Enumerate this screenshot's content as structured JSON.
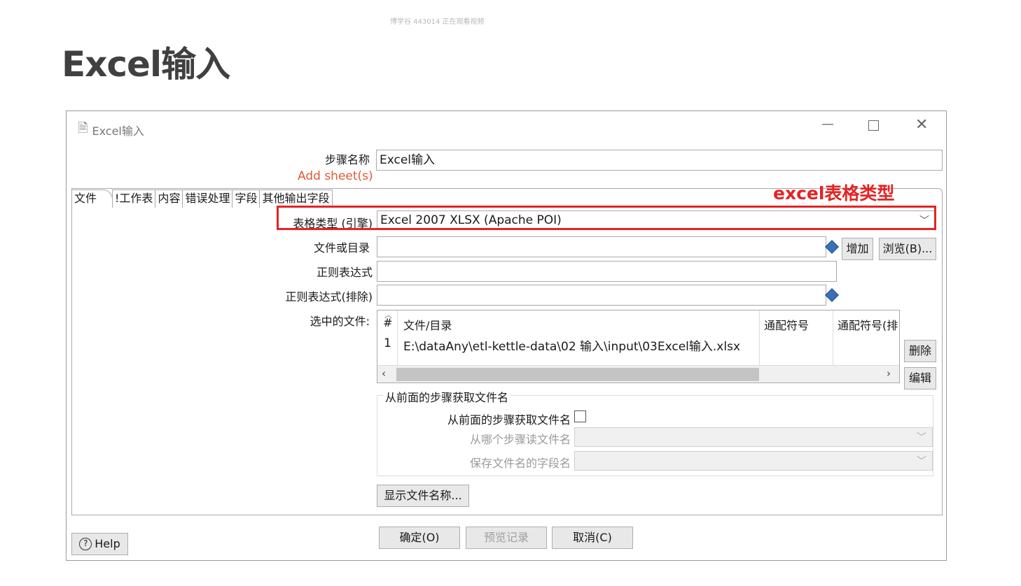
{
  "watermark": "博学谷 443014 正在观看视频",
  "slide_title": "Excel输入",
  "dialog": {
    "title": "Excel输入",
    "window_controls": [
      "minimize-icon",
      "maximize-icon",
      "close-icon"
    ],
    "step_name_label": "步骤名称",
    "step_name_value": "Excel输入",
    "add_sheet_label": "Add sheet(s)",
    "tabs": [
      "文件",
      "!工作表",
      "内容",
      "错误处理",
      "字段",
      "其他输出字段"
    ],
    "annotation": "excel表格类型",
    "spreadsheet_type_label": "表格类型 (引擎)",
    "spreadsheet_type_value": "Excel 2007 XLSX (Apache POI)",
    "file_or_dir_label": "文件或目录",
    "file_or_dir_value": "",
    "regex_label": "正则表达式",
    "regex_value": "",
    "regex_exclude_label": "正则表达式(排除)",
    "regex_exclude_value": "",
    "add_button": "增加",
    "browse_button": "浏览(B)...",
    "selected_files_label": "选中的文件:",
    "table": {
      "columns": [
        "#",
        "文件/目录",
        "通配符号",
        "通配符号(排"
      ],
      "rows": [
        {
          "index": "1",
          "path": "E:\\dataAny\\etl-kettle-data\\02 输入\\input\\03Excel输入.xlsx",
          "wildcard": "",
          "wildcard_exclude": ""
        }
      ]
    },
    "delete_button": "删除",
    "edit_button": "编辑",
    "group": {
      "title": "从前面的步骤获取文件名",
      "accept_label": "从前面的步骤获取文件名",
      "accept_checked": false,
      "step_read_label": "从哪个步骤读文件名",
      "step_read_value": "",
      "field_name_label": "保存文件名的字段名",
      "field_name_value": ""
    },
    "show_filenames_button": "显示文件名称...",
    "ok_button": "确定(O)",
    "preview_button": "预览记录",
    "cancel_button": "取消(C)",
    "help_button": "Help"
  },
  "colors": {
    "annotation": "#e52323",
    "add_sheet": "#e25a32"
  }
}
